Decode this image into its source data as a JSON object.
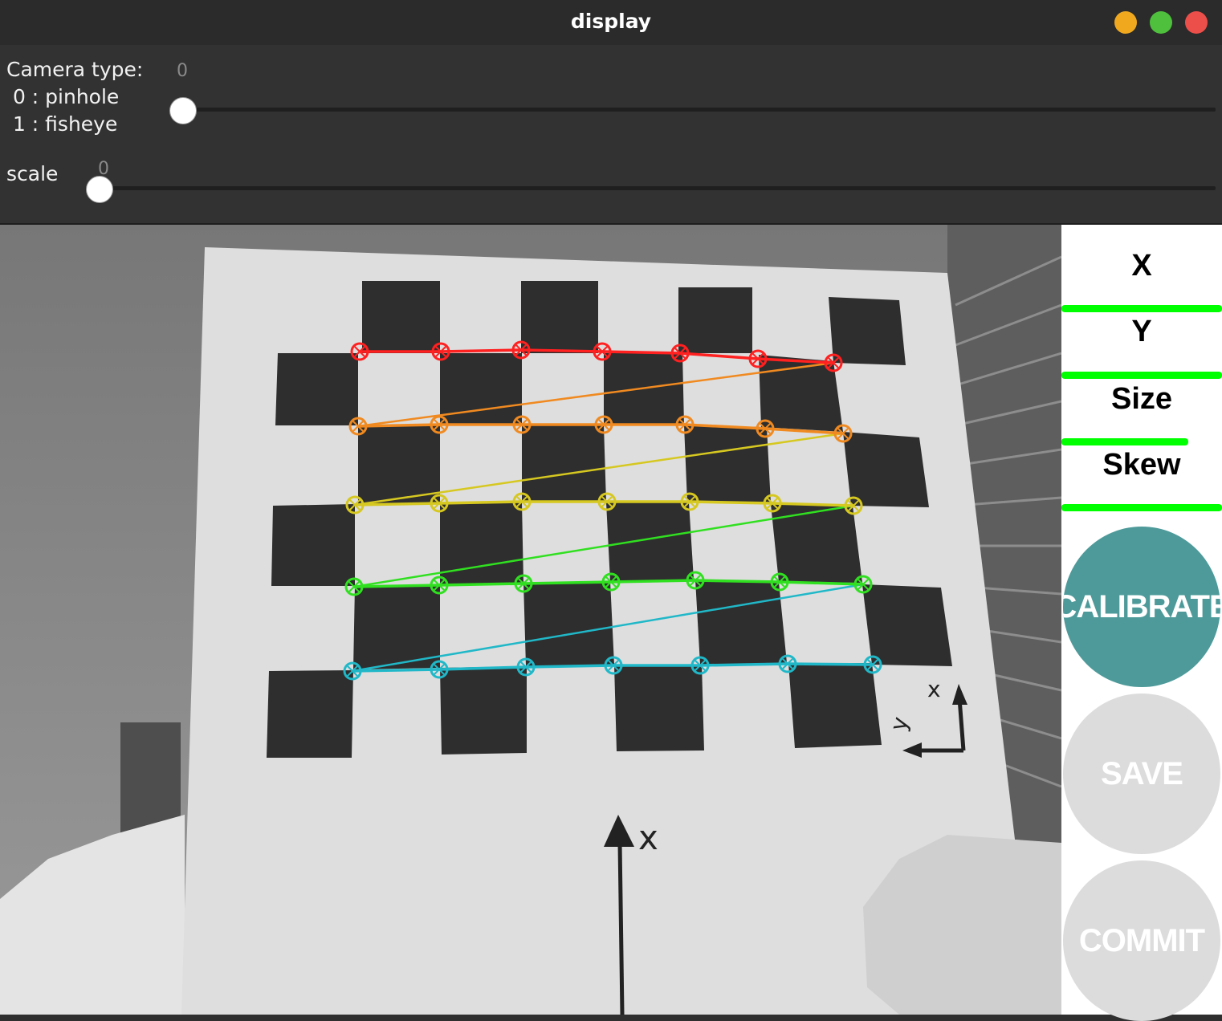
{
  "window": {
    "title": "display",
    "buttons": [
      "minimize",
      "maximize",
      "close"
    ]
  },
  "controls": {
    "camera_type": {
      "label_line1": "Camera type:",
      "label_line2": " 0 : pinhole",
      "label_line3": " 1 : fisheye",
      "value": "0"
    },
    "scale": {
      "label": "scale",
      "value": "0"
    }
  },
  "camera_view": {
    "board_axis_labels": [
      "x",
      "y",
      "x"
    ],
    "row_colors": [
      "#ff2020",
      "#f08a20",
      "#d6c820",
      "#30e020",
      "#20b8c8"
    ]
  },
  "sidebar": {
    "metrics": [
      {
        "label": "X",
        "bar_color": "#00ff00"
      },
      {
        "label": "Y",
        "bar_color": "#00ff00"
      },
      {
        "label": "Size",
        "bar_color": "#00ff00"
      },
      {
        "label": "Skew",
        "bar_color": "#00ff00"
      }
    ],
    "buttons": {
      "calibrate": "CALIBRATE",
      "save": "SAVE",
      "commit": "COMMIT"
    },
    "accent": "#4e9a9a",
    "disabled": "#dcdcdc"
  }
}
